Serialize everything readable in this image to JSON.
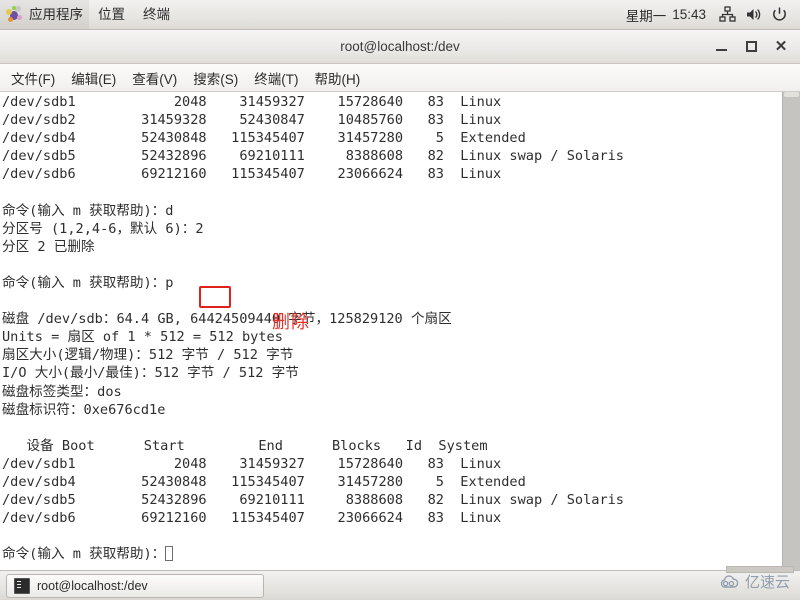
{
  "top_panel": {
    "apps_label": "应用程序",
    "places_label": "位置",
    "terminal_label": "终端",
    "day_label": "星期一",
    "time_label": "15:43",
    "icons": [
      "gnome-foot-icon",
      "network-icon",
      "volume-icon",
      "power-icon"
    ]
  },
  "window": {
    "title": "root@localhost:/dev",
    "minimize_label": "_",
    "maximize_label": "□",
    "close_label": "✕",
    "menu": [
      {
        "label": "文件(F)"
      },
      {
        "label": "编辑(E)"
      },
      {
        "label": "查看(V)"
      },
      {
        "label": "搜索(S)"
      },
      {
        "label": "终端(T)"
      },
      {
        "label": "帮助(H)"
      }
    ]
  },
  "terminal": {
    "lines": [
      "/dev/sdb1            2048    31459327    15728640   83  Linux",
      "/dev/sdb2        31459328    52430847    10485760   83  Linux",
      "/dev/sdb4        52430848   115345407    31457280    5  Extended",
      "/dev/sdb5        52432896    69210111     8388608   82  Linux swap / Solaris",
      "/dev/sdb6        69212160   115345407    23066624   83  Linux",
      "",
      "命令(输入 m 获取帮助)：d",
      "分区号 (1,2,4-6，默认 6)：2",
      "分区 2 已删除",
      "",
      "命令(输入 m 获取帮助)：p",
      "",
      "磁盘 /dev/sdb：64.4 GB, 64424509440 字节，125829120 个扇区",
      "Units = 扇区 of 1 * 512 = 512 bytes",
      "扇区大小(逻辑/物理)：512 字节 / 512 字节",
      "I/O 大小(最小/最佳)：512 字节 / 512 字节",
      "磁盘标签类型：dos",
      "磁盘标识符：0xe676cd1e",
      "",
      "   设备 Boot      Start         End      Blocks   Id  System",
      "/dev/sdb1            2048    31459327    15728640   83  Linux",
      "/dev/sdb4        52430848   115345407    31457280    5  Extended",
      "/dev/sdb5        52432896    69210111     8388608   82  Linux swap / Solaris",
      "/dev/sdb6        69212160   115345407    23066624   83  Linux",
      "",
      "命令(输入 m 获取帮助)："
    ],
    "annotation": {
      "highlight_target": "d",
      "label": "删除",
      "color": "#e8302a",
      "box_color": "#e0201a"
    }
  },
  "bottom_panel": {
    "task_label": "root@localhost:/dev",
    "watermark_text": "亿速云"
  }
}
